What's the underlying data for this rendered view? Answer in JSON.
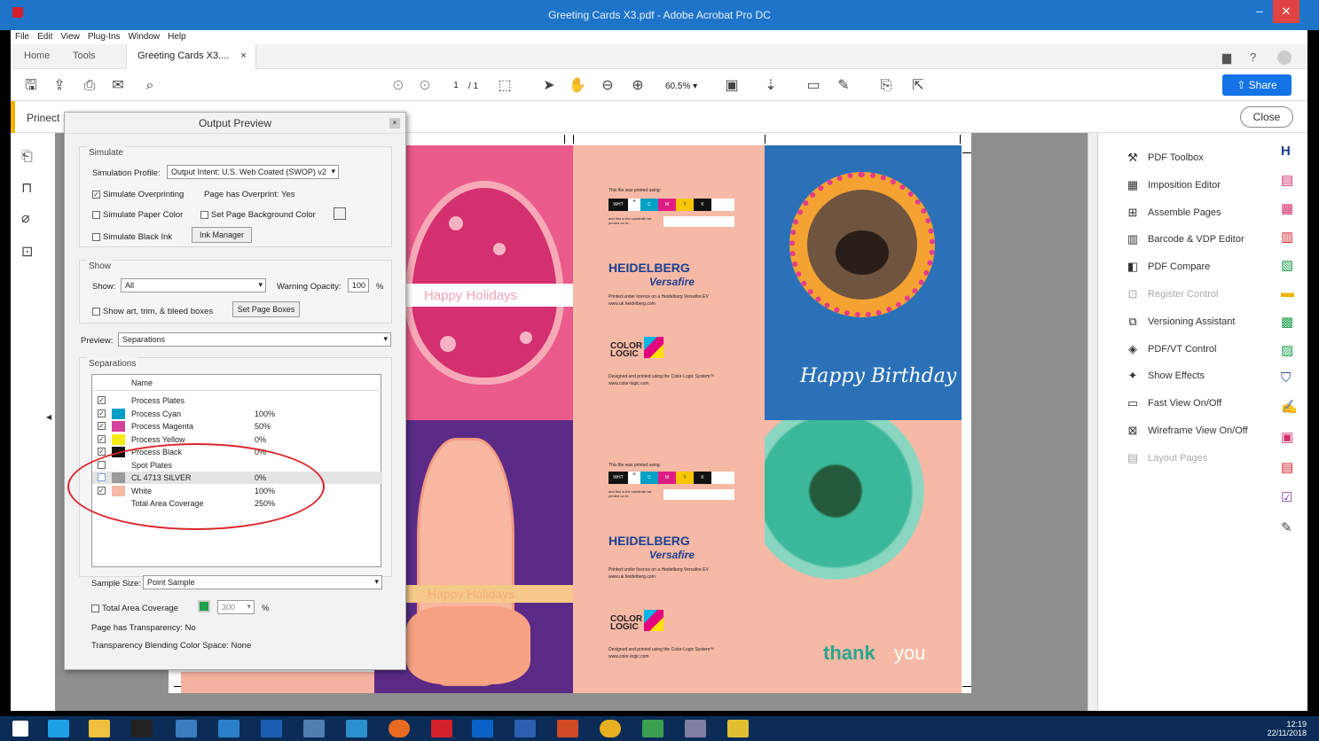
{
  "window": {
    "title": "Greeting Cards X3.pdf - Adobe Acrobat Pro DC"
  },
  "menu": [
    "File",
    "Edit",
    "View",
    "Plug-Ins",
    "Window",
    "Help"
  ],
  "tabs": {
    "home": "Home",
    "tools": "Tools",
    "doc": "Greeting Cards X3....",
    "close": "×"
  },
  "toolbar": {
    "page_current": "1",
    "page_total": "/ 1",
    "zoom": "60.5%",
    "share": "Share"
  },
  "prinect": {
    "label": "Prinect",
    "close": "Close"
  },
  "dialog": {
    "title": "Output Preview",
    "simulate": {
      "group": "Simulate",
      "profile_label": "Simulation Profile:",
      "profile_value": "Output Intent: U.S. Web Coated (SWOP) v2",
      "simulate_overprinting": "Simulate Overprinting",
      "page_has_overprint": "Page has Overprint:  Yes",
      "simulate_paper_color": "Simulate Paper Color",
      "set_page_bg": "Set Page Background Color",
      "simulate_black_ink": "Simulate Black Ink",
      "ink_manager": "Ink Manager"
    },
    "show": {
      "group": "Show",
      "show_label": "Show:",
      "show_value": "All",
      "warning_label": "Warning Opacity:",
      "warning_value": "100",
      "pct": "%",
      "show_boxes": "Show art, trim, & bleed boxes",
      "set_page_boxes": "Set Page Boxes"
    },
    "preview_label": "Preview:",
    "preview_value": "Separations",
    "separations": {
      "group": "Separations",
      "name_header": "Name",
      "rows": [
        {
          "name": "Process Plates",
          "pct": "",
          "checked": true,
          "swatch": ""
        },
        {
          "name": "Process Cyan",
          "pct": "100%",
          "checked": true,
          "swatch": "#00a0c6"
        },
        {
          "name": "Process Magenta",
          "pct": "50%",
          "checked": true,
          "swatch": "#d4409a"
        },
        {
          "name": "Process Yellow",
          "pct": "0%",
          "checked": true,
          "swatch": "#f5ea14"
        },
        {
          "name": "Process Black",
          "pct": "0%",
          "checked": true,
          "swatch": "#111111"
        },
        {
          "name": "Spot Plates",
          "pct": "",
          "checked": false,
          "swatch": ""
        },
        {
          "name": "CL 4713 SILVER",
          "pct": "0%",
          "checked": false,
          "swatch": "#9a9a9a"
        },
        {
          "name": "White",
          "pct": "100%",
          "checked": true,
          "swatch": "#f4b9a5"
        },
        {
          "name": "Total Area Coverage",
          "pct": "250%",
          "checked": false,
          "swatch": ""
        }
      ]
    },
    "sample_size_label": "Sample Size:",
    "sample_size_value": "Point Sample",
    "tac_label": "Total Area Coverage",
    "tac_value": "300",
    "tac_pct": "%",
    "page_transparency": "Page has Transparency:  No",
    "blending_space": "Transparency Blending Color Space:  None"
  },
  "tools_panel": [
    {
      "label": "PDF Toolbox",
      "icon": "toolbox-icon",
      "enabled": true
    },
    {
      "label": "Imposition Editor",
      "icon": "imposition-icon",
      "enabled": true
    },
    {
      "label": "Assemble Pages",
      "icon": "assemble-icon",
      "enabled": true
    },
    {
      "label": "Barcode & VDP Editor",
      "icon": "barcode-icon",
      "enabled": true
    },
    {
      "label": "PDF Compare",
      "icon": "compare-icon",
      "enabled": true
    },
    {
      "label": "Register Control",
      "icon": "register-icon",
      "enabled": false
    },
    {
      "label": "Versioning Assistant",
      "icon": "versioning-icon",
      "enabled": true
    },
    {
      "label": "PDF/VT Control",
      "icon": "pdfvt-icon",
      "enabled": true
    },
    {
      "label": "Show Effects",
      "icon": "effects-icon",
      "enabled": true
    },
    {
      "label": "Fast View On/Off",
      "icon": "fastview-icon",
      "enabled": true
    },
    {
      "label": "Wireframe View On/Off",
      "icon": "wireframe-icon",
      "enabled": true
    },
    {
      "label": "Layout Pages",
      "icon": "layout-icon",
      "enabled": false
    }
  ],
  "cards": {
    "happy_holidays": "Happy Holidays",
    "heidelberg": "HEIDELBERG",
    "versafire": "Versafire",
    "printed_using": "This file was printed using:",
    "licence": "Printed under licence on a Heidelberg Versafire EV",
    "heidelberg_url": "www.uk.heidelberg.com",
    "colorlogic_1": "COLOR",
    "colorlogic_2": "LOGIC",
    "designed": "Designed and printed using the Color-Logic System™",
    "colorlogic_url": "www.color-logic.com",
    "substrate": "and this is the substrate we printed on to...",
    "happy_birthday": "Happy Birthday",
    "thank": "thank",
    "you": "you",
    "swatches": [
      "WHT",
      "+",
      "C",
      "M",
      "Y",
      "K"
    ]
  },
  "clock": {
    "time": "12:19",
    "date": "22/11/2018"
  },
  "colors": {
    "accent": "#1473e6",
    "titlebar": "#1e74c8",
    "annotation": "#d9252b"
  }
}
